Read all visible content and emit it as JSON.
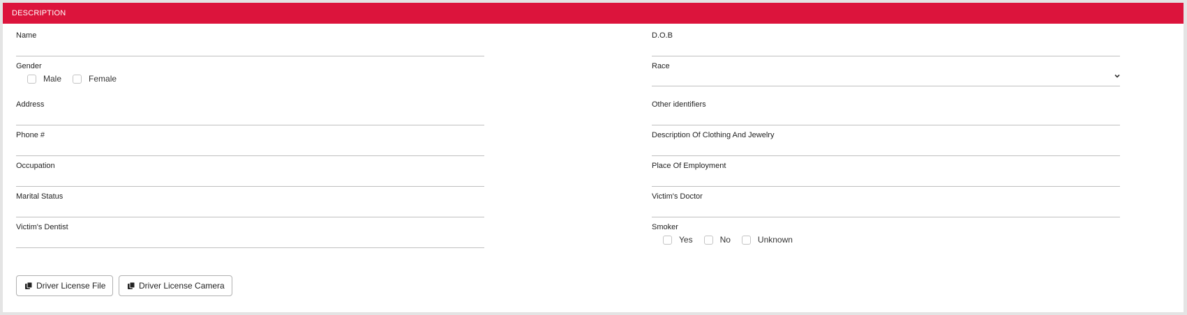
{
  "section": {
    "title": "DESCRIPTION"
  },
  "fields": {
    "name": {
      "label": "Name",
      "value": ""
    },
    "dob": {
      "label": "D.O.B",
      "value": ""
    },
    "gender": {
      "label": "Gender",
      "options": [
        {
          "label": "Male",
          "checked": false
        },
        {
          "label": "Female",
          "checked": false
        }
      ]
    },
    "race": {
      "label": "Race",
      "value": ""
    },
    "address": {
      "label": "Address",
      "value": ""
    },
    "other_identifiers": {
      "label": "Other identifiers",
      "value": ""
    },
    "phone": {
      "label": "Phone #",
      "value": ""
    },
    "clothing": {
      "label": "Description Of Clothing And Jewelry",
      "value": ""
    },
    "occupation": {
      "label": "Occupation",
      "value": ""
    },
    "employment": {
      "label": "Place Of Employment",
      "value": ""
    },
    "marital_status": {
      "label": "Marital Status",
      "value": ""
    },
    "doctor": {
      "label": "Victim's Doctor",
      "value": ""
    },
    "dentist": {
      "label": "Victim's Dentist",
      "value": ""
    },
    "smoker": {
      "label": "Smoker",
      "options": [
        {
          "label": "Yes",
          "checked": false
        },
        {
          "label": "No",
          "checked": false
        },
        {
          "label": "Unknown",
          "checked": false
        }
      ]
    }
  },
  "buttons": {
    "license_file": "Driver License File",
    "license_camera": "Driver License Camera"
  },
  "icons": {
    "select_arrow": "chevron-down-icon",
    "button_icon": "copy-files-icon"
  },
  "colors": {
    "header_bg": "#dc143c",
    "header_text": "#ffffff",
    "field_border": "#bfbfbf"
  }
}
